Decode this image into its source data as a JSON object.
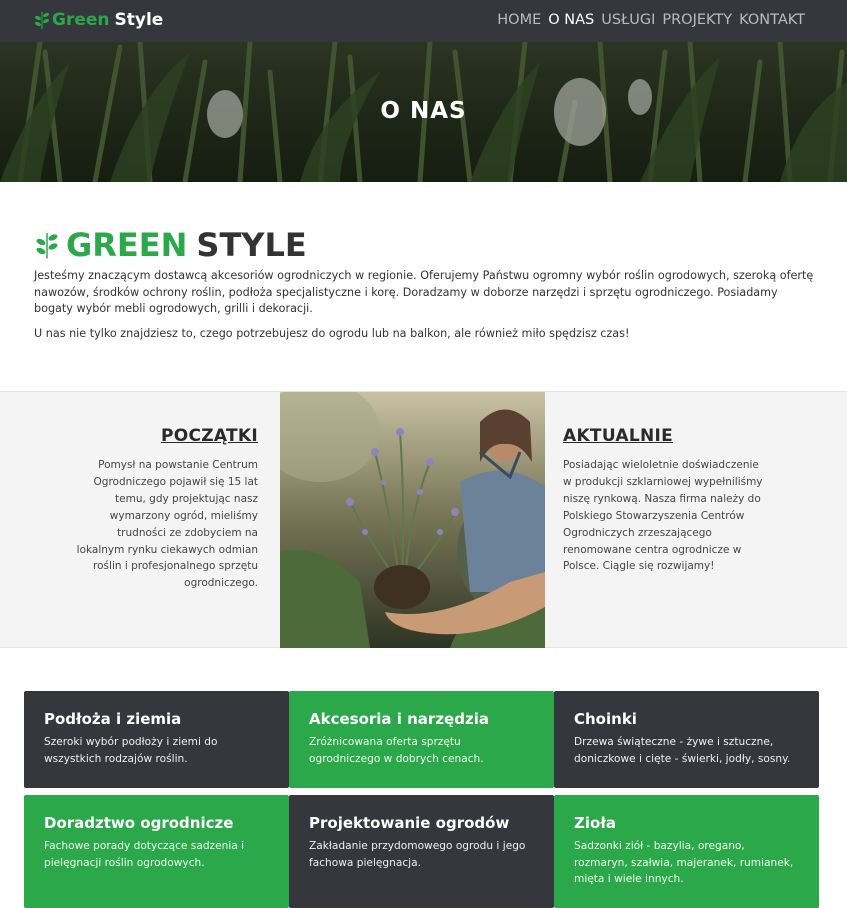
{
  "colors": {
    "brand_green": "#2ba84a",
    "dark": "#35373d",
    "light_bg": "#f4f4f4"
  },
  "navbar": {
    "logo": {
      "green": "Green",
      "white": "Style",
      "icon": "leaf-icon"
    },
    "links": [
      {
        "label": "HOME",
        "active": false
      },
      {
        "label": "O NAS",
        "active": true
      },
      {
        "label": "USŁUGI",
        "active": false
      },
      {
        "label": "PROJEKTY",
        "active": false
      },
      {
        "label": "KONTAKT",
        "active": false
      }
    ]
  },
  "hero": {
    "title": "O NAS"
  },
  "about": {
    "title_green": "GREEN",
    "title_dark": "STYLE",
    "paragraphs": [
      "Jesteśmy znaczącym dostawcą akcesoriów ogrodniczych w regionie. Oferujemy Państwu ogromny wybór roślin ogrodowych, szeroką ofertę nawozów, środków ochrony roślin, podłoża specjalistyczne i korę. Doradzamy w doborze narzędzi i sprzętu ogrodniczego. Posiadamy bogaty wybór mebli ogrodowych, grilli i dekoracji.",
      "U nas nie tylko znajdziesz to, czego potrzebujesz do ogrodu lub na balkon, ale również miło spędzisz czas!"
    ]
  },
  "history": {
    "left": {
      "heading": "POCZĄTKI",
      "text": "Pomysł na powstanie Centrum Ogrodniczego pojawił się 15 lat temu, gdy projektując nasz wymarzony ogród, mieliśmy trudności ze zdobyciem na lokalnym rynku ciekawych odmian roślin i profesjonalnego sprzętu ogrodniczego."
    },
    "right": {
      "heading": "AKTUALNIE",
      "text": "Posiadając wieloletnie doświadczenie w produkcji szklarniowej wypełniliśmy niszę rynkową. Nasza firma należy do Polskiego Stowarzyszenia Centrów Ogrodniczych zrzeszającego renomowane centra ogrodnicze w Polsce. Ciągle się rozwijamy!"
    }
  },
  "services": [
    {
      "title": "Podłoża i ziemia",
      "text": "Szeroki wybór podłoży i ziemi do wszystkich rodzajów roślin.",
      "style": "dark"
    },
    {
      "title": "Akcesoria i narzędzia",
      "text": "Zróżnicowana oferta sprzętu ogrodniczego w dobrych cenach.",
      "style": "green"
    },
    {
      "title": "Choinki",
      "text": "Drzewa świąteczne - żywe i sztuczne, doniczkowe i cięte - świerki, jodły, sosny.",
      "style": "dark"
    },
    {
      "title": "Doradztwo ogrodnicze",
      "text": "Fachowe porady dotyczące sadzenia i pielęgnacji roślin ogrodowych.",
      "style": "green"
    },
    {
      "title": "Projektowanie ogrodów",
      "text": "Zakładanie przydomowego ogrodu i jego fachowa pielęgnacja.",
      "style": "dark"
    },
    {
      "title": "Zioła",
      "text": "Sadzonki ziół - bazylia, oregano, rozmaryn, szałwia, majeranek, rumianek, mięta i wiele innych.",
      "style": "green"
    }
  ]
}
